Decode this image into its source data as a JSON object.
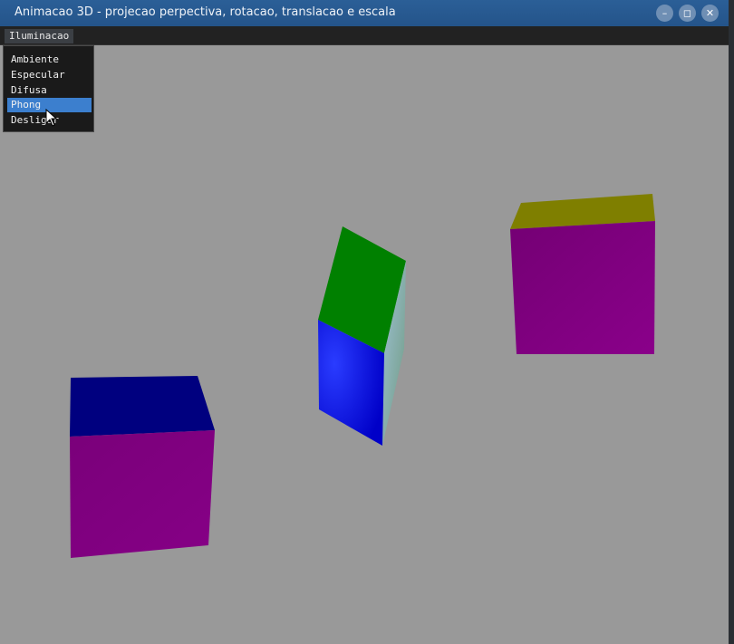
{
  "window": {
    "title": "Animacao 3D - projecao perpectiva, rotacao, translacao e escala",
    "controls": {
      "minimize": "–",
      "maximize": "◻",
      "close": "✕"
    }
  },
  "menubar": {
    "menu_title": "Iluminacao",
    "items": [
      {
        "label": "Ambiente"
      },
      {
        "label": "Especular"
      },
      {
        "label": "Difusa"
      },
      {
        "label": "Phong",
        "selected": true
      },
      {
        "label": "Desligar"
      }
    ]
  },
  "scene": {
    "background_color": "#999999",
    "cubes": [
      {
        "name": "left-cube",
        "face_colors": [
          "#00007f",
          "#800080"
        ]
      },
      {
        "name": "center-cube",
        "face_colors": [
          "#008000",
          "#0000ff",
          "#8fb0c8"
        ]
      },
      {
        "name": "right-cube",
        "face_colors": [
          "#7f7f00",
          "#800080"
        ]
      }
    ]
  },
  "colors": {
    "accent_selected": "#3c7fce",
    "titlebar": "#24548a"
  }
}
